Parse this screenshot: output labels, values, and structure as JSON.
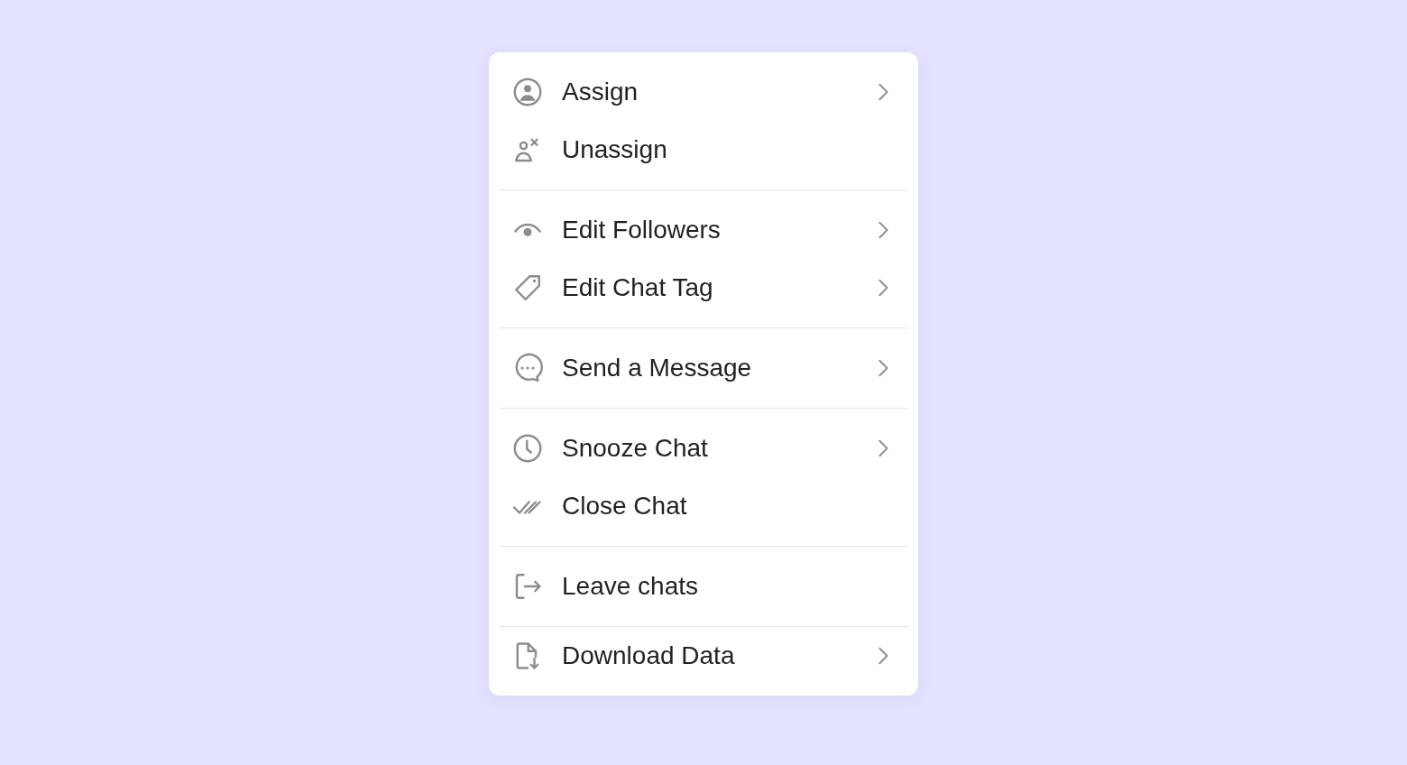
{
  "menu": {
    "groups": [
      {
        "items": [
          {
            "label": "Assign",
            "submenu": true
          },
          {
            "label": "Unassign",
            "submenu": false
          }
        ]
      },
      {
        "items": [
          {
            "label": "Edit Followers",
            "submenu": true
          },
          {
            "label": "Edit Chat Tag",
            "submenu": true
          }
        ]
      },
      {
        "items": [
          {
            "label": "Send a Message",
            "submenu": true
          }
        ]
      },
      {
        "items": [
          {
            "label": "Snooze Chat",
            "submenu": true
          },
          {
            "label": "Close Chat",
            "submenu": false
          }
        ]
      },
      {
        "items": [
          {
            "label": "Leave chats",
            "submenu": false
          }
        ]
      },
      {
        "items": [
          {
            "label": "Download Data",
            "submenu": true
          }
        ]
      }
    ]
  }
}
